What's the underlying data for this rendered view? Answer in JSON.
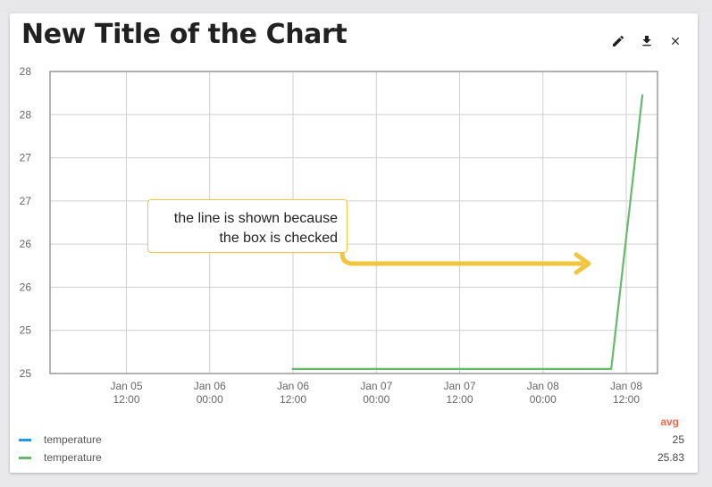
{
  "card": {
    "title": "New Title of the Chart",
    "tools": [
      {
        "name": "edit-icon"
      },
      {
        "name": "download-icon"
      },
      {
        "name": "close-icon"
      }
    ]
  },
  "chart_data": {
    "type": "line",
    "y_tick_labels": [
      "28",
      "28",
      "27",
      "27",
      "26",
      "26",
      "25",
      "25"
    ],
    "ylim": [
      24.95,
      28.25
    ],
    "x_tick_labels": [
      [
        "Jan 05",
        "12:00"
      ],
      [
        "Jan 06",
        "00:00"
      ],
      [
        "Jan 06",
        "12:00"
      ],
      [
        "Jan 07",
        "00:00"
      ],
      [
        "Jan 07",
        "12:00"
      ],
      [
        "Jan 08",
        "00:00"
      ],
      [
        "Jan 08",
        "12:00"
      ]
    ],
    "x_ticks": [
      "2024-01-05T12:00",
      "2024-01-06T00:00",
      "2024-01-06T12:00",
      "2024-01-07T00:00",
      "2024-01-07T12:00",
      "2024-01-08T00:00",
      "2024-01-08T12:00"
    ],
    "xlim": [
      "2024-01-05T01:00",
      "2024-01-08T16:30"
    ],
    "grid": true,
    "series": [
      {
        "name": "temperature",
        "color": "#2196f3",
        "points": []
      },
      {
        "name": "temperature",
        "color": "#66bb6a",
        "points": [
          {
            "x": "2024-01-06T11:50",
            "y": 25
          },
          {
            "x": "2024-01-08T09:50",
            "y": 25
          },
          {
            "x": "2024-01-08T14:20",
            "y": 28
          }
        ]
      }
    ]
  },
  "legend": {
    "avg_header": "avg",
    "rows": [
      {
        "label": "temperature",
        "color": "#2196f3",
        "avg": "25"
      },
      {
        "label": "temperature",
        "color": "#66bb6a",
        "avg": "25.83"
      }
    ]
  },
  "annotation": {
    "line1": "the line is shown because",
    "line2": "the box is checked",
    "color": "#f2c53f"
  }
}
